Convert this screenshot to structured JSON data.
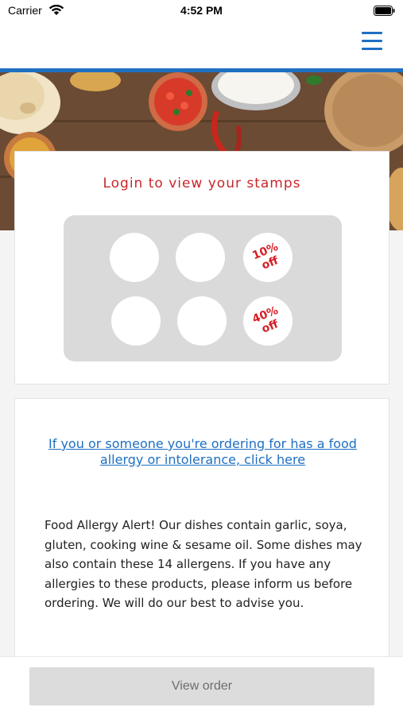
{
  "status_bar": {
    "carrier": "Carrier",
    "time": "4:52 PM"
  },
  "nav": {
    "menu_icon": "hamburger-menu-icon"
  },
  "hero": {
    "image": "indian-food-banner"
  },
  "stamps": {
    "title": "Login to view your stamps",
    "rewards": [
      {
        "line1": "10%",
        "line2": "off"
      },
      {
        "line1": "40%",
        "line2": "off"
      }
    ],
    "empty_stamp_count": 4
  },
  "allergy": {
    "link_text": "If you or someone you're ordering for has a food allergy or intolerance, click here",
    "alert_text": "Food Allergy Alert! Our dishes contain garlic, soya, gluten, cooking wine & sesame oil. Some dishes may also contain these 14 allergens. If you have any allergies to these products, please inform us before ordering. We will do our best to advise you."
  },
  "bottom": {
    "view_order_label": "View order"
  },
  "colors": {
    "accent_blue": "#1f6fc2",
    "brand_red": "#c8262a",
    "grey_button": "#dcdcdc"
  }
}
